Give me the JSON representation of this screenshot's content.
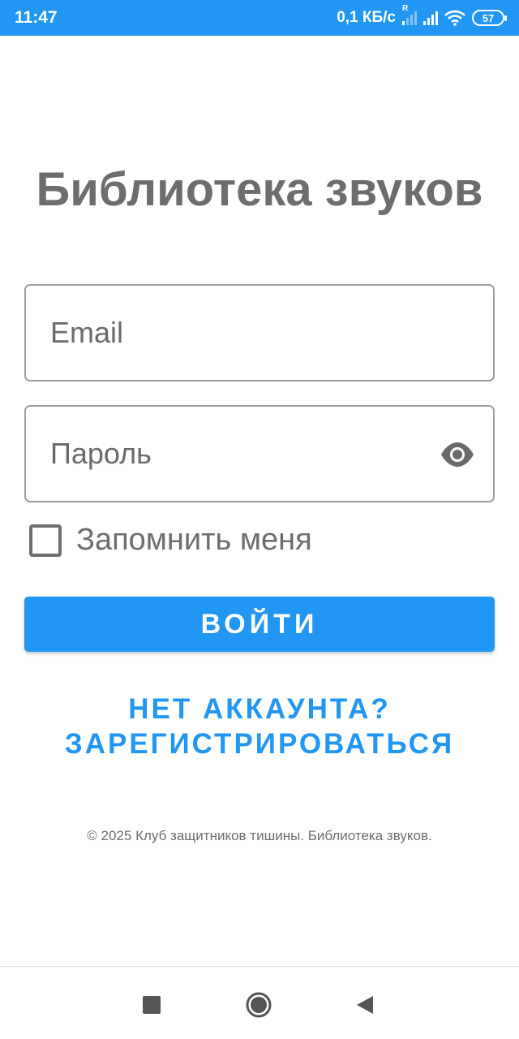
{
  "status_bar": {
    "time": "11:47",
    "speed": "0,1 КБ/с",
    "roaming": "R",
    "battery": "57",
    "icons": [
      "signal-roaming-icon",
      "signal-icon",
      "wifi-icon",
      "battery-icon"
    ]
  },
  "app": {
    "title": "Библиотека звуков"
  },
  "form": {
    "email_placeholder": "Email",
    "password_placeholder": "Пароль",
    "password_toggle_icon": "eye-icon",
    "remember_label": "Запомнить меня",
    "remember_checked": false,
    "login_label": "ВОЙТИ",
    "register_line1": "НЕТ АККАУНТА?",
    "register_line2": "ЗАРЕГИСТРИРОВАТЬСЯ"
  },
  "footer": {
    "text": "© 2025 Клуб защитников тишины. Библиотека звуков."
  },
  "nav": {
    "icons": [
      "recent-apps-icon",
      "home-icon",
      "back-icon"
    ]
  },
  "colors": {
    "accent": "#2196F3",
    "text_gray": "#6d6d6d",
    "border": "#9e9e9e"
  }
}
